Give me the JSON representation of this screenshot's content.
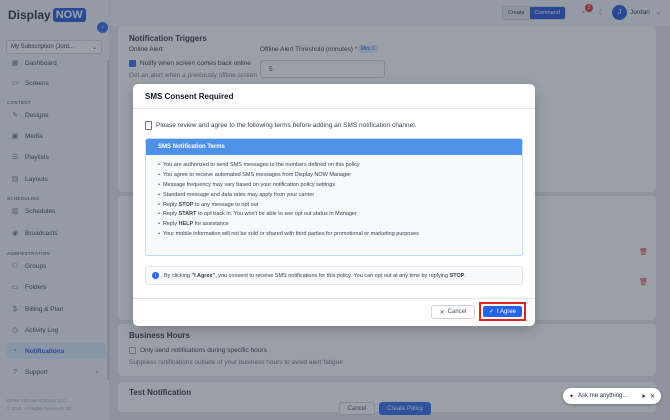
{
  "app": {
    "logo_display": "Display",
    "logo_now": "NOW"
  },
  "sidebar": {
    "subscription": "My Subscription (Jord...",
    "sections": {
      "content": "CONTENT",
      "scheduling": "SCHEDULING",
      "administration": "ADMINISTRATION"
    },
    "items": [
      {
        "label": "Dashboard",
        "icon": "dashboard-icon"
      },
      {
        "label": "Screens",
        "icon": "monitor-icon"
      },
      {
        "label": "Designs",
        "icon": "design-icon"
      },
      {
        "label": "Media",
        "icon": "image-icon"
      },
      {
        "label": "Playlists",
        "icon": "playlist-icon"
      },
      {
        "label": "Layouts",
        "icon": "layout-icon"
      },
      {
        "label": "Schedules",
        "icon": "calendar-icon"
      },
      {
        "label": "Broadcasts",
        "icon": "broadcast-icon"
      },
      {
        "label": "Groups",
        "icon": "groups-icon"
      },
      {
        "label": "Folders",
        "icon": "folder-icon"
      },
      {
        "label": "Billing & Plan",
        "icon": "billing-icon"
      },
      {
        "label": "Activity Log",
        "icon": "activity-icon"
      },
      {
        "label": "Notifications",
        "icon": "bell-icon"
      },
      {
        "label": "Support",
        "icon": "support-icon"
      }
    ],
    "footer_company": "DUKE TECHNOLOGIES LLC",
    "footer_copy": "© 2026. All Rights Reserved. 33"
  },
  "topbar": {
    "mode_create": "Create",
    "mode_command": "Command",
    "notif_count": "3",
    "user_initial": "J",
    "user_name": "Jordan"
  },
  "background": {
    "triggers_title": "Notification Triggers",
    "online_alert": "Online Alert",
    "notify_back_online": "Notify when screen comes back online",
    "alert_desc": "Get an alert when a previously offline screen",
    "offline_threshold": "Offline Alert Threshold (minutes)",
    "required_mark": "*",
    "min_pill": "Min: 1",
    "threshold_value": "5",
    "business_hours_title": "Business Hours",
    "business_hours_check": "Only send notifications during specific hours",
    "business_hours_desc": "Suppress notifications outside of your business hours to avoid alert fatigue",
    "test_title": "Test Notification",
    "cancel": "Cancel",
    "create_policy": "Create Policy"
  },
  "modal": {
    "title": "SMS Consent Required",
    "intro": "Please review and agree to the following terms before adding an SMS notification channel.",
    "terms_title": "SMS Notification Terms",
    "terms": [
      "You are authorized to send SMS messages to the numbers defined on this policy",
      "You agree to receive automated SMS messages from Display NOW Manager",
      "Message frequency may vary based on your notification policy settings",
      "Standard message and data rates may apply from your carrier"
    ],
    "term_stop_pre": "Reply ",
    "term_stop_key": "STOP",
    "term_stop_post": " to any message to opt out",
    "term_start_pre": "Reply ",
    "term_start_key": "START",
    "term_start_post": " to opt back in. You won't be able to see opt out status in Manager",
    "term_help_pre": "Reply ",
    "term_help_key": "HELP",
    "term_help_post": " for assistance",
    "term_privacy": "Your mobile information will not be sold or shared with third parties for promotional or marketing purposes",
    "notice_pre": "By clicking ",
    "notice_key": "\"I Agree\"",
    "notice_mid": ", you consent to receive SMS notifications for this policy. You can opt out at any time by replying ",
    "notice_stop": "STOP",
    "notice_end": ".",
    "cancel_label": "Cancel",
    "agree_label": "I Agree"
  },
  "assistant": {
    "label": "Ask me anything..."
  }
}
